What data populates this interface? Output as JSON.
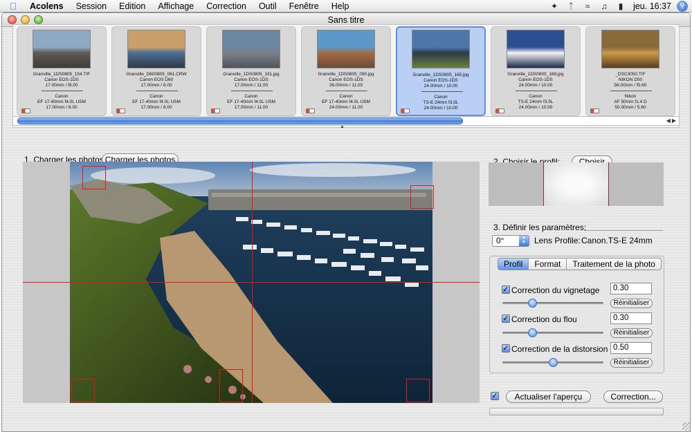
{
  "menubar": {
    "app_name": "Acolens",
    "items": [
      "Session",
      "Edition",
      "Affichage",
      "Correction",
      "Outil",
      "Fenêtre",
      "Help"
    ],
    "clock": "jeu. 16:37"
  },
  "window": {
    "title": "Sans titre"
  },
  "filmstrip": {
    "cards": [
      {
        "file": "Granville_1DS0805_154.TIF",
        "camera": "Canon EOS-1DS",
        "setting": "17.00mm / f8.00",
        "brand": "Canon",
        "lens": "EF 17-40mm f4.0L USM",
        "lens_setting": "17.00mm / 8.00"
      },
      {
        "file": "Granville_D600805_061.CRW",
        "camera": "Canon EOS D60",
        "setting": "17.00mm / 8.00",
        "brand": "Canon",
        "lens": "EF 17-40mm f4.0L USM",
        "lens_setting": "17.00mm / 8.00"
      },
      {
        "file": "Granville_1DS0805_191.jpg",
        "camera": "Canon EOS-1DS",
        "setting": "17.00mm / 11.00",
        "brand": "Canon",
        "lens": "EF 17-40mm f4.0L USM",
        "lens_setting": "17.00mm / 11.00"
      },
      {
        "file": "Granville_1DS0805_090.jpg",
        "camera": "Canon EOS-1DS",
        "setting": "26.00mm / 11.00",
        "brand": "Canon",
        "lens": "EF 17-40mm f4.0L USM",
        "lens_setting": "24.00mm / 11.00"
      },
      {
        "file": "Granville_1DS0805_165.jpg",
        "camera": "Canon EOS-1DS",
        "setting": "24.00mm / 10.00",
        "brand": "Canon",
        "lens": "TS-E 24mm f3.5L",
        "lens_setting": "24.00mm / 10.00"
      },
      {
        "file": "Granville_1DS0805_169.jpg",
        "camera": "Canon EOS-1DS",
        "setting": "24.00mm / 10.00",
        "brand": "Canon",
        "lens": "TS-E 24mm f3.5L",
        "lens_setting": "24.00mm / 10.00"
      },
      {
        "file": "_DSC3050.TIF",
        "camera": "NIKON D50",
        "setting": "56.00mm / f5.60",
        "brand": "Nikon",
        "lens": "AF 50mm f1.4 D",
        "lens_setting": "50.00mm / 5.60"
      }
    ]
  },
  "step1": {
    "label": "1. Charger les photos:",
    "button": "Charger les photos"
  },
  "step2": {
    "label": "2. Choisir le profil:",
    "button": "Choisir"
  },
  "step3": {
    "label": "3. Définir les paramètres:",
    "rotation": "0°",
    "lens_profile_label": "Lens Profile:",
    "lens_profile_value": "Canon.TS-E 24mm"
  },
  "tabs": [
    "Profil",
    "Format",
    "Traitement de la photo"
  ],
  "corrections": [
    {
      "label": "Correction du vignetage",
      "value": "0.30",
      "reset": "Réinitialiser"
    },
    {
      "label": "Correction du flou",
      "value": "0.30",
      "reset": "Réinitialiser"
    },
    {
      "label": "Correction de la distorsion",
      "value": "0.50",
      "reset": "Réinitialiser"
    }
  ],
  "actions": {
    "preview_button": "Actualiser l'aperçu",
    "correction_button": "Correction..."
  },
  "colors": {
    "accent": "#3f7ae0",
    "guide": "#e01818"
  }
}
